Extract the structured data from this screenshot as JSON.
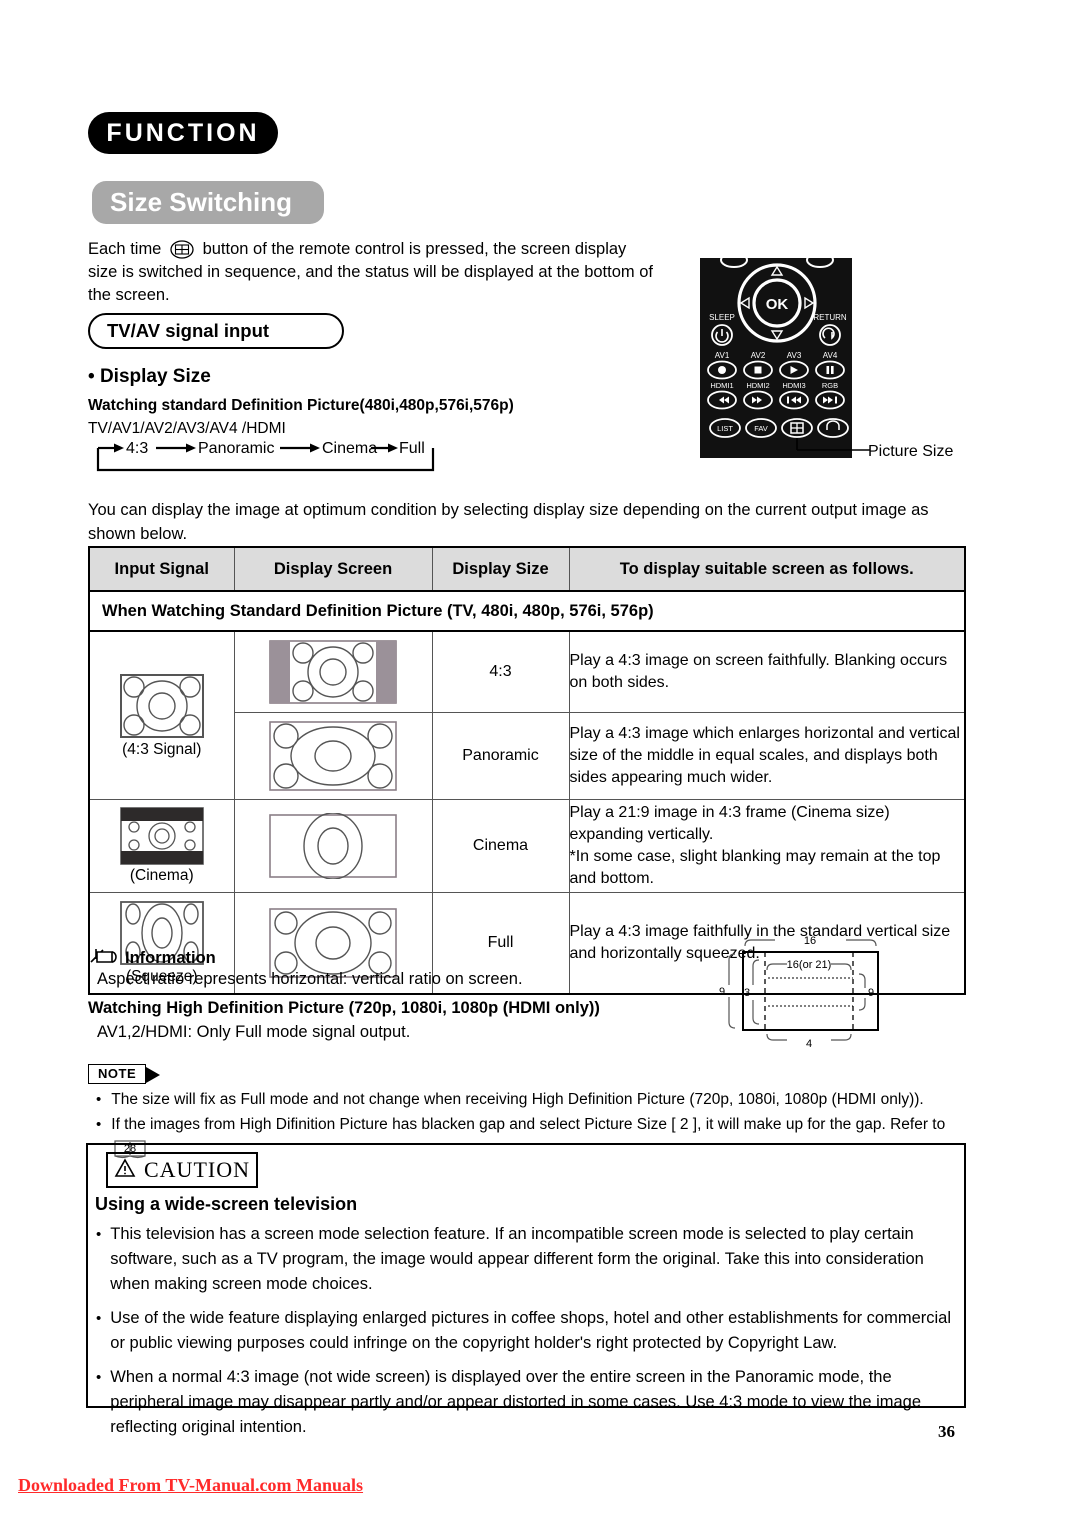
{
  "header": {
    "function_pill": "FUNCTION",
    "section_pill": "Size Switching"
  },
  "intro": {
    "before_icon": "Each time",
    "icon": "picture-size-icon",
    "after_icon": "button of the remote control is pressed, the screen display size is switched in sequence, and the status will be displayed at the bottom of the screen."
  },
  "tvav_box": {
    "label": "TV/AV signal input"
  },
  "display_size": {
    "heading": "Display Size",
    "sd_heading": "Watching standard Definition Picture(480i,480p,576i,576p)",
    "input_list": "TV/AV1/AV2/AV3/AV4 /HDMI",
    "flow": [
      "4:3",
      "Panoramic",
      "Cinema",
      "Full"
    ]
  },
  "remote": {
    "ok_label": "OK",
    "sleep_label": "SLEEP",
    "return_label": "RETURN",
    "av_labels": [
      "AV1",
      "AV2",
      "AV3",
      "AV4"
    ],
    "hdmi_labels": [
      "HDMI1",
      "HDMI2",
      "HDMI3",
      "RGB"
    ],
    "bottom_labels": [
      "LIST",
      "FAV"
    ],
    "callout": "Picture Size"
  },
  "body_paragraph": "You can display the image at optimum condition by selecting display size depending on the current output image as shown below.",
  "table": {
    "headers": [
      "Input Signal",
      "Display Screen",
      "Display Size",
      "To display suitable screen as follows."
    ],
    "subhead": "When Watching Standard Definition Picture (TV, 480i, 480p, 576i, 576p)",
    "rows": [
      {
        "input_caption": "(4:3 Signal)",
        "input_kind": "signal-4-3",
        "screen_kind": "screen-4-3-pillarbox",
        "size": "4:3",
        "description": "Play a 4:3 image on screen faithfully. Blanking occurs on both sides."
      },
      {
        "input_caption": "",
        "input_kind": "",
        "screen_kind": "screen-panoramic",
        "size": "Panoramic",
        "description": "Play a 4:3 image which enlarges horizontal and vertical size of the middle in equal scales, and displays both sides appearing much wider."
      },
      {
        "input_caption": "(Cinema)",
        "input_kind": "signal-cinema",
        "screen_kind": "screen-cinema",
        "size": "Cinema",
        "description": "Play a 21:9 image in 4:3 frame (Cinema size) expanding vertically.\n*In some case, slight blanking may remain at the top and bottom."
      },
      {
        "input_caption": "(Squeeze)",
        "input_kind": "signal-squeeze",
        "screen_kind": "screen-full",
        "size": "Full",
        "description": "Play a 4:3 image faithfully in the standard vertical size and horizontally squeezed."
      }
    ]
  },
  "information": {
    "heading": "Information",
    "text": "Aspect ratio represents horizontal: vertical ratio on screen.",
    "hd_heading": "Watching High Definition Picture (720p, 1080i, 1080p (HDMI only))",
    "hd_text": "AV1,2/HDMI: Only Full mode signal output."
  },
  "aspect_diagram": {
    "top": "16",
    "inner_top": "16(or 21)",
    "left_outer": "9",
    "left_inner": "3",
    "right_inner": "9",
    "bottom": "4"
  },
  "note": {
    "tag": "NOTE",
    "items": [
      {
        "text": "The size will fix as Full mode and not change when receiving High Definition Picture (720p, 1080i, 1080p (HDMI only))."
      },
      {
        "text_before": "If the images from High Difinition Picture has blacken gap and select Picture Size [ 2 ], it will make up for the gap. Refer to",
        "page_ref": "28",
        "text_after": "."
      }
    ]
  },
  "caution": {
    "tag": "CAUTION",
    "subtitle": "Using a wide-screen television",
    "items": [
      "This television has a screen mode selection feature. If an incompatible screen mode is selected to play certain software, such as a TV program, the image would appear different form the original. Take this into consideration when making screen mode choices.",
      "Use of the wide feature displaying enlarged pictures in coffee shops, hotel and other establishments for commercial or public viewing purposes could infringe on the copyright holder's right protected by Copyright Law.",
      "When a normal 4:3 image (not wide screen) is displayed over the entire screen in the Panoramic mode, the peripheral image may disappear partly and/or appear distorted in some cases. Use 4:3 mode to view the image reflecting original intention."
    ]
  },
  "footer": {
    "page_number": "36",
    "download_link": "Downloaded From TV-Manual.com Manuals"
  },
  "colors": {
    "pill_dark": "#000000",
    "pill_gray": "#a8a8a8",
    "table_header_bg": "#dcdcdc",
    "link_red": "#ff2a2a"
  }
}
